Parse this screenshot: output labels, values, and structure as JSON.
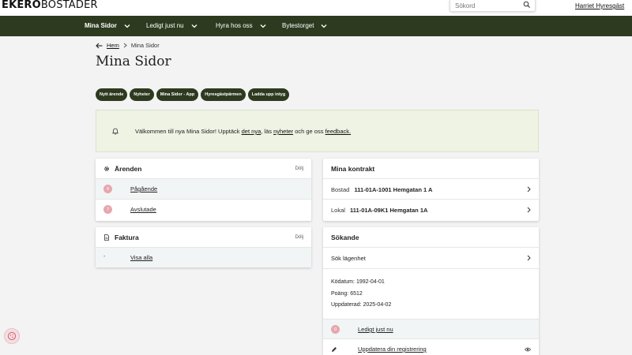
{
  "header": {
    "logo_bold": "EKERÖ",
    "logo_light": "BOSTÄDER",
    "search_placeholder": "Sökord",
    "user_name": "Harriet Hyresgäst"
  },
  "nav": {
    "items": [
      {
        "label": "Mina Sidor"
      },
      {
        "label": "Ledigt just nu"
      },
      {
        "label": "Hyra hos oss"
      },
      {
        "label": "Bytestorget"
      }
    ]
  },
  "breadcrumb": {
    "home": "Hem",
    "current": "Mina Sidor"
  },
  "page_title": "Mina Sidor",
  "quick_links": [
    "Nytt ärende",
    "Nyheter",
    "Mina Sidor - App",
    "Hyresgästpärmen",
    "Ladda upp intyg"
  ],
  "banner": {
    "text_1": "Välkommen till nya Mina Sidor! Upptäck ",
    "link_1": "det nya",
    "text_2": ", läs ",
    "link_2": "nyheter",
    "text_3": " och ge oss ",
    "link_3": "feedback."
  },
  "arenden": {
    "title": "Ärenden",
    "hide": "Dölj",
    "rows": [
      {
        "count": "0",
        "label": "Pågående"
      },
      {
        "count": "7",
        "label": "Avslutade"
      }
    ]
  },
  "faktura": {
    "title": "Faktura",
    "hide": "Dölj",
    "marker": "-",
    "link": "Visa alla"
  },
  "kontrakt": {
    "title": "Mina kontrakt",
    "rows": [
      {
        "type": "Bostad",
        "value": "111-01A-1001 Hemgatan 1 A"
      },
      {
        "type": "Lokal",
        "value": "111-01A-09K1 Hemgatan 1A"
      }
    ]
  },
  "sokande": {
    "title": "Sökande",
    "search_label": "Sök lägenhet",
    "info": [
      {
        "key": "Ködatum:",
        "value": "1992-04-01"
      },
      {
        "key": "Poäng:",
        "value": "6512"
      },
      {
        "key": "Uppdaterad:",
        "value": "2025-04-02"
      }
    ],
    "available": {
      "count": "0",
      "label": "Ledigt just nu"
    },
    "update_label": "Uppdatera din registrering"
  },
  "colors": {
    "nav_bg": "#2e3a1f",
    "banner_bg": "#eef3e4",
    "badge": "#e6a7ae"
  }
}
